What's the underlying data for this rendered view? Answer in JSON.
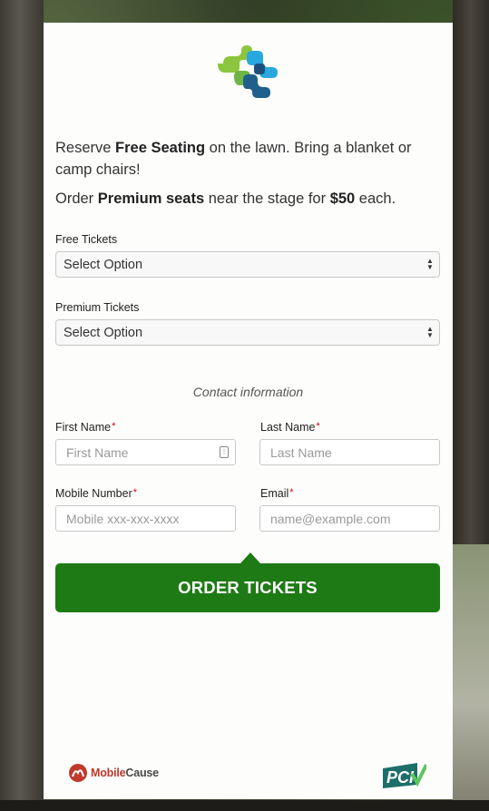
{
  "intro": {
    "line1_pre": "Reserve ",
    "line1_bold": "Free Seating",
    "line1_post": " on the lawn. Bring a blanket or camp chairs!",
    "line2_pre": "Order ",
    "line2_bold": "Premium seats",
    "line2_mid": " near the stage for ",
    "line2_price": "$50",
    "line2_post": " each."
  },
  "free_tickets": {
    "label": "Free Tickets",
    "value": "Select Option"
  },
  "premium_tickets": {
    "label": "Premium Tickets",
    "value": "Select Option"
  },
  "contact": {
    "title": "Contact information",
    "first_name": {
      "label": "First Name",
      "placeholder": "First Name"
    },
    "last_name": {
      "label": "Last Name",
      "placeholder": "Last Name"
    },
    "mobile": {
      "label": "Mobile Number",
      "placeholder": "Mobile xxx-xxx-xxxx"
    },
    "email": {
      "label": "Email",
      "placeholder": "name@example.com"
    },
    "required_mark": "*"
  },
  "order_button": "ORDER TICKETS",
  "footer": {
    "brand_a": "Mobile",
    "brand_b": "Cause",
    "pci_text": "PCI"
  },
  "colors": {
    "accent": "#1e7a14",
    "required": "#d0021b"
  },
  "icons": [
    "org-logo-icon",
    "select-arrows-icon",
    "autofill-contact-icon",
    "mobilecause-logo-icon",
    "pci-badge-icon"
  ]
}
